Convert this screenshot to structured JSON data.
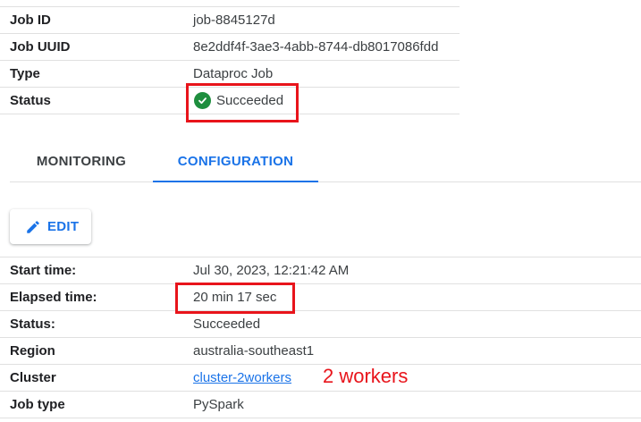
{
  "job_details": {
    "rows": [
      {
        "label": "Job ID",
        "value": "job-8845127d"
      },
      {
        "label": "Job UUID",
        "value": "8e2ddf4f-3ae3-4abb-8744-db8017086fdd"
      },
      {
        "label": "Type",
        "value": "Dataproc Job"
      },
      {
        "label": "Status",
        "value": "Succeeded",
        "icon": "check-circle-icon"
      }
    ]
  },
  "tabs": [
    {
      "label": "MONITORING",
      "active": false
    },
    {
      "label": "CONFIGURATION",
      "active": true
    }
  ],
  "edit_button": {
    "label": "EDIT",
    "icon": "pencil-icon"
  },
  "configuration": {
    "rows": [
      {
        "label": "Start time:",
        "value": "Jul 30, 2023, 12:21:42 AM"
      },
      {
        "label": "Elapsed time:",
        "value": "20 min 17 sec"
      },
      {
        "label": "Status:",
        "value": "Succeeded"
      },
      {
        "label": "Region",
        "value": "australia-southeast1"
      },
      {
        "label": "Cluster",
        "value": "cluster-2workers",
        "link": true
      },
      {
        "label": "Job type",
        "value": "PySpark"
      }
    ]
  },
  "annotation": {
    "text": "2 workers"
  },
  "colors": {
    "accent": "#1a73e8",
    "success": "#1e8e3e",
    "highlight": "#e8141b"
  }
}
